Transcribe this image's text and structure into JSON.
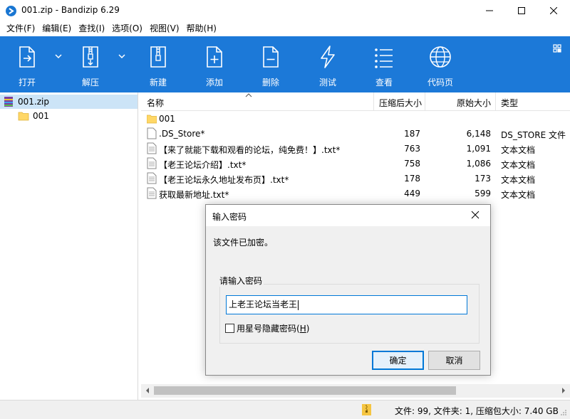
{
  "window": {
    "title": "001.zip - Bandizip 6.29",
    "accent": "#1c79d8"
  },
  "menu": [
    "文件(F)",
    "编辑(E)",
    "查找(I)",
    "选项(O)",
    "视图(V)",
    "帮助(H)"
  ],
  "toolbar": {
    "buttons": [
      {
        "label": "打开",
        "icon": "open-archive-icon"
      },
      {
        "label": "解压",
        "icon": "extract-icon"
      },
      {
        "label": "新建",
        "icon": "new-archive-icon"
      },
      {
        "label": "添加",
        "icon": "add-file-icon"
      },
      {
        "label": "删除",
        "icon": "delete-file-icon"
      },
      {
        "label": "测试",
        "icon": "test-lightning-icon"
      },
      {
        "label": "查看",
        "icon": "view-list-icon"
      },
      {
        "label": "代码页",
        "icon": "codepage-globe-icon"
      }
    ]
  },
  "tree": {
    "root": "001.zip",
    "child": "001"
  },
  "list": {
    "headers": {
      "name": "名称",
      "packed": "压缩后大小",
      "original": "原始大小",
      "type": "类型"
    },
    "rows": [
      {
        "name": "001",
        "packed": "",
        "original": "",
        "type": "",
        "kind": "folder"
      },
      {
        "name": ".DS_Store*",
        "packed": "187",
        "original": "6,148",
        "type": "DS_STORE 文件",
        "kind": "file"
      },
      {
        "name": "【来了就能下载和观看的论坛，纯免费！】.txt*",
        "packed": "763",
        "original": "1,091",
        "type": "文本文档",
        "kind": "text"
      },
      {
        "name": "【老王论坛介绍】.txt*",
        "packed": "758",
        "original": "1,086",
        "type": "文本文档",
        "kind": "text"
      },
      {
        "name": "【老王论坛永久地址发布页】.txt*",
        "packed": "178",
        "original": "173",
        "type": "文本文档",
        "kind": "text"
      },
      {
        "name": "获取最新地址.txt*",
        "packed": "449",
        "original": "599",
        "type": "文本文档",
        "kind": "text"
      }
    ]
  },
  "status": {
    "text": "文件: 99, 文件夹: 1, 压缩包大小: 7.40 GB"
  },
  "dialog": {
    "title": "输入密码",
    "message": "该文件已加密。",
    "group_label": "请输入密码",
    "password_value": "上老王论坛当老王",
    "hide_label": "用星号隐藏密码(",
    "hide_key": "H",
    "hide_tail": ")",
    "hide_checked": false,
    "ok_label": "确定",
    "cancel_label": "取消"
  }
}
